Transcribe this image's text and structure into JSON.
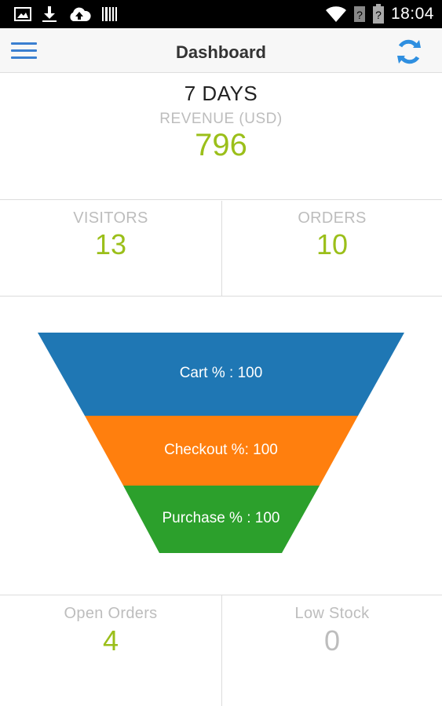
{
  "status_bar": {
    "time": "18:04",
    "left_icons": [
      "image-icon",
      "download-icon",
      "cloud-upload-icon",
      "barcode-icon"
    ],
    "right_icons": [
      "wifi-icon",
      "signal-unknown-icon",
      "battery-unknown-icon"
    ]
  },
  "header": {
    "title": "Dashboard",
    "menu_icon": "hamburger-menu-icon",
    "refresh_icon": "refresh-icon"
  },
  "revenue": {
    "period": "7 DAYS",
    "label": "REVENUE (USD)",
    "value": "796"
  },
  "stats": {
    "visitors": {
      "label": "VISITORS",
      "value": "13"
    },
    "orders": {
      "label": "ORDERS",
      "value": "10"
    }
  },
  "funnel": {
    "stages": [
      {
        "label": "Cart % : 100",
        "percent": 100,
        "color": "#1f77b4"
      },
      {
        "label": "Checkout %: 100",
        "percent": 100,
        "color": "#ff7f0e"
      },
      {
        "label": "Purchase % : 100",
        "percent": 100,
        "color": "#2ca02c"
      }
    ]
  },
  "bottom_stats": {
    "open_orders": {
      "label": "Open Orders",
      "value": "4"
    },
    "low_stock": {
      "label": "Low Stock",
      "value": "0"
    }
  },
  "colors": {
    "accent_green": "#9bbf1a",
    "muted_gray": "#bdbdbd",
    "brand_blue": "#3a7fd0"
  }
}
